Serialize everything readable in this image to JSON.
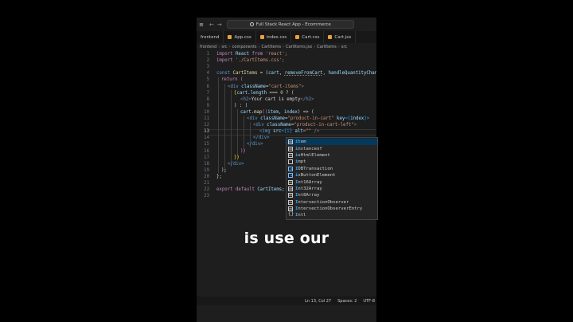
{
  "window": {
    "title": "Full Stack React App - Ecommerce"
  },
  "tabs": [
    {
      "label": "frontend",
      "type": "folder"
    },
    {
      "label": "App.css",
      "type": "css"
    },
    {
      "label": "index.css",
      "type": "css"
    },
    {
      "label": "Cart.css",
      "type": "css"
    },
    {
      "label": "Cart.jsx",
      "type": "jsx"
    }
  ],
  "breadcrumb": [
    "frontend",
    "src",
    "components",
    "CartItems",
    "CartItems.jsx",
    "CartItems",
    "src"
  ],
  "line_numbers": [
    "1",
    "2",
    "3",
    "4",
    "5",
    "6",
    "7",
    "8",
    "9",
    "10",
    "11",
    "12",
    "13",
    "14",
    "15",
    "16",
    "17",
    "18",
    "19",
    "20",
    "21",
    "22",
    "23"
  ],
  "active_line": "13",
  "code": {
    "l1": [
      "import",
      " React ",
      "from",
      " 'react';"
    ],
    "l2": [
      "import",
      " './CartItems.css';"
    ],
    "l4a": "const ",
    "l4b": "CartItems",
    "l4c": " = (",
    "l4d": "cart",
    "l4e": ", ",
    "l4f": "removeFromCart",
    "l4g": ", ",
    "l4h": "handleQuantityChang",
    "l5": "return (",
    "l6a": "<",
    "l6b": "div",
    "l6c": " className",
    "l6d": "=",
    "l6e": "\"cart-items\"",
    "l6f": ">",
    "l7a": "{",
    "l7b": "cart",
    "l7c": ".",
    "l7d": "length",
    "l7e": " === ",
    "l7f": "0",
    "l7g": " ? (",
    "l8a": "<",
    "l8b": "h2",
    "l8c": ">",
    "l8d": "Your cart is empty",
    "l8e": "</",
    "l8f": "h2",
    "l8g": ">",
    "l9": ") : (",
    "l10a": "cart",
    "l10b": ".",
    "l10c": "map",
    "l10d": "((",
    "l10e": "item",
    "l10f": ", ",
    "l10g": "index",
    "l10h": ") => (",
    "l11a": "<",
    "l11b": "div",
    "l11c": " className",
    "l11d": "=",
    "l11e": "\"product-in-cart\"",
    "l11f": " key",
    "l11g": "={",
    "l11h": "index",
    "l11i": "}>",
    "l12a": "<",
    "l12b": "div",
    "l12c": " className",
    "l12d": "=",
    "l12e": "\"product-in-cart-left\"",
    "l12f": ">",
    "l13a": "<",
    "l13b": "img",
    "l13c": " src",
    "l13d": "={i}",
    "l13e": " alt",
    "l13f": "=\"\"",
    "l13g": " />",
    "l14": "</div>",
    "l15": "</div>",
    "l16": "))",
    "l17": "})",
    "l18": "</div>",
    "l19": ");",
    "l20": "};",
    "l22a": "export",
    "l22b": " default ",
    "l22c": "CartItems;"
  },
  "suggestions": [
    {
      "prefix": "i",
      "rest": "tem",
      "kind": "abc"
    },
    {
      "prefix": "i",
      "rest": "nstanceof",
      "kind": "abc"
    },
    {
      "prefix": "i",
      "rest": "sHtmlElement",
      "kind": "abc"
    },
    {
      "prefix": "i",
      "rest": "mpt",
      "kind": "snippet-box"
    },
    {
      "prefix": "I",
      "rest": "DBTransaction",
      "kind": "interface"
    },
    {
      "prefix": "i",
      "rest": "sButtonElement",
      "kind": "interface"
    },
    {
      "prefix": "I",
      "rest": "nt16Array",
      "kind": "abc"
    },
    {
      "prefix": "I",
      "rest": "nt32Array",
      "kind": "abc"
    },
    {
      "prefix": "I",
      "rest": "nt8Array",
      "kind": "abc"
    },
    {
      "prefix": "I",
      "rest": "ntersectionObserver",
      "kind": "abc"
    },
    {
      "prefix": "I",
      "rest": "ntersectionObserverEntry",
      "kind": "abc"
    },
    {
      "prefix": "I",
      "rest": "ntl",
      "kind": "braces"
    }
  ],
  "caption": "is use our",
  "status": {
    "position": "Ln 13, Col 27",
    "spaces": "Spaces: 2",
    "encoding": "UTF-8"
  }
}
